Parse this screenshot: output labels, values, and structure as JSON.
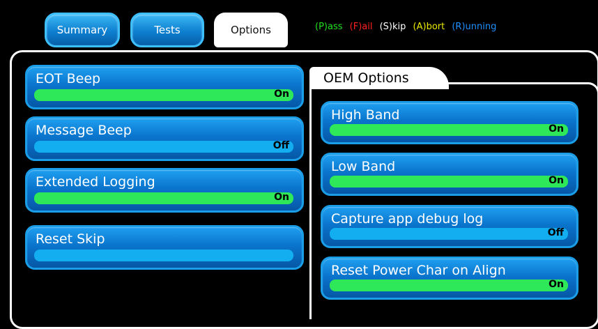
{
  "tabs": {
    "summary": "Summary",
    "tests": "Tests",
    "options": "Options"
  },
  "legend": {
    "pass": "(P)ass",
    "fail": "(F)ail",
    "skip": "(S)kip",
    "abort": "(A)bort",
    "running": "(R)unning"
  },
  "colors": {
    "pass": "#20e020",
    "fail": "#ff2020",
    "skip": "#ffffff",
    "abort": "#e8e800",
    "running": "#1e90ff",
    "on_bar": "#2fe85a",
    "off_bar": "#12aef0"
  },
  "options": {
    "eot_beep": {
      "label": "EOT Beep",
      "state": "On"
    },
    "message_beep": {
      "label": "Message Beep",
      "state": "Off"
    },
    "extended_logging": {
      "label": "Extended Logging",
      "state": "On"
    },
    "reset_skip": {
      "label": "Reset Skip",
      "state": ""
    }
  },
  "oem": {
    "title": "OEM Options",
    "high_band": {
      "label": "High Band",
      "state": "On"
    },
    "low_band": {
      "label": "Low Band",
      "state": "On"
    },
    "capture_debug": {
      "label": "Capture app debug log",
      "state": "Off"
    },
    "reset_power": {
      "label": "Reset Power Char on Align",
      "state": "On"
    }
  }
}
